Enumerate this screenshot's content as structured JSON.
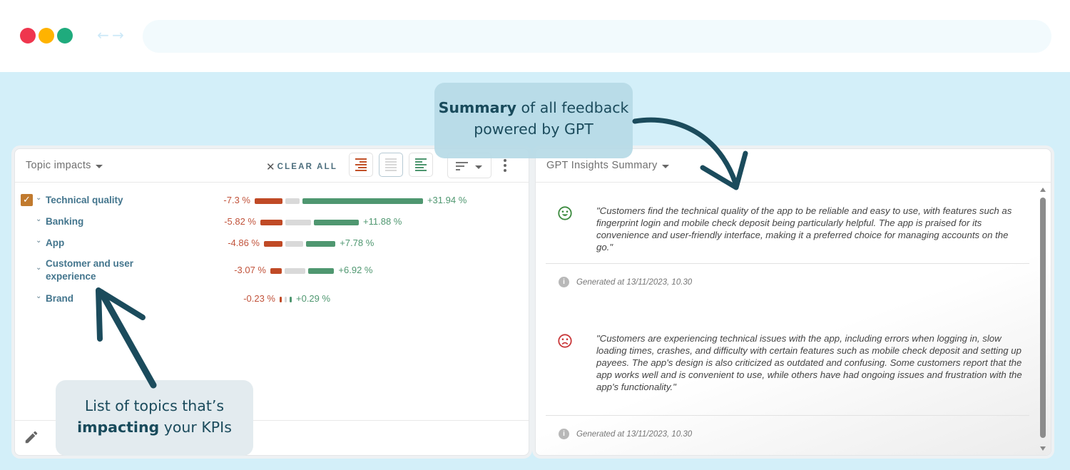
{
  "browser": {
    "window_controls": [
      "close",
      "minimize",
      "maximize"
    ],
    "nav_icons": [
      "arrow-left-icon",
      "arrow-right-icon"
    ],
    "url": ""
  },
  "topic_panel": {
    "title": "Topic impacts",
    "clear_all_label": "CLEAR ALL",
    "view_buttons": [
      "negative-view",
      "neutral-view",
      "positive-view"
    ],
    "active_view": "neutral-view",
    "sort_icon": "sort-icon",
    "more_icon": "more-vertical-icon",
    "footer_icon": "pencil-icon",
    "topics": [
      {
        "label": "Technical quality",
        "checked": true,
        "negative": "-7.3 %",
        "positive": "+31.94 %",
        "neg_value": -7.3,
        "pos_value": 31.94
      },
      {
        "label": "Banking",
        "checked": false,
        "negative": "-5.82 %",
        "positive": "+11.88 %",
        "neg_value": -5.82,
        "pos_value": 11.88
      },
      {
        "label": "App",
        "checked": false,
        "negative": "-4.86 %",
        "positive": "+7.78 %",
        "neg_value": -4.86,
        "pos_value": 7.78
      },
      {
        "label": "Customer and user experience",
        "label_line1": "Customer and user",
        "label_line2": "experience",
        "checked": false,
        "negative": "-3.07 %",
        "positive": "+6.92 %",
        "neg_value": -3.07,
        "pos_value": 6.92
      },
      {
        "label": "Brand",
        "checked": false,
        "negative": "-0.23 %",
        "positive": "+0.29 %",
        "neg_value": -0.23,
        "pos_value": 0.29
      }
    ]
  },
  "gpt_panel": {
    "title": "GPT Insights Summary",
    "insights": [
      {
        "sentiment": "positive",
        "icon": "smiley-happy-icon",
        "color": "#3b8a3e",
        "text": "\"Customers find the technical quality of the app to be reliable and easy to use, with features such as fingerprint login and mobile check deposit being particularly helpful. The app is praised for its convenience and user-friendly interface, making it a preferred choice for managing accounts on the go.\"",
        "generated": "Generated at 13/11/2023, 10.30"
      },
      {
        "sentiment": "negative",
        "icon": "smiley-sad-icon",
        "color": "#c9383a",
        "text": "\"Customers are experiencing technical issues with the app, including errors when logging in, slow loading times, crashes, and difficulty with certain features such as mobile check deposit and setting up payees. The app's design is also criticized as outdated and confusing. Some customers report that the app works well and is convenient to use, while others have had ongoing issues and frustration with the app's functionality.\"",
        "generated": "Generated at 13/11/2023, 10.30"
      }
    ]
  },
  "annotations": {
    "summary_callout": {
      "bold": "Summary",
      "rest_line1": " of all feedback",
      "line2": "powered by GPT"
    },
    "topics_callout": {
      "line1": "List of topics that’s",
      "bold": "impacting",
      "rest_line2": " your KPIs"
    }
  },
  "colors": {
    "negative": "#c04a26",
    "neutral": "#d9d9d9",
    "positive": "#4f9770",
    "topic_label": "#43758d",
    "annotation": "#184a5b",
    "backdrop": "#d3eff9"
  }
}
